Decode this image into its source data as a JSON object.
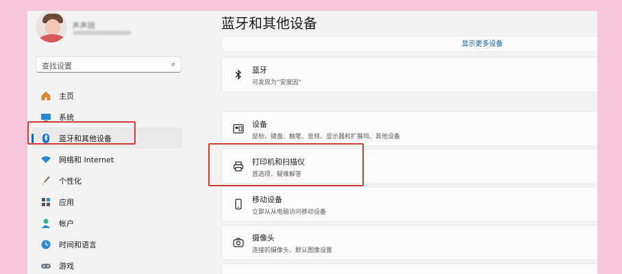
{
  "user": {
    "name": "声声回"
  },
  "search": {
    "placeholder": "查找设置"
  },
  "nav": [
    {
      "label": "主页",
      "icon": "home-icon"
    },
    {
      "label": "系统",
      "icon": "system-icon"
    },
    {
      "label": "蓝牙和其他设备",
      "icon": "bluetooth-icon",
      "selected": true
    },
    {
      "label": "网络和 Internet",
      "icon": "wifi-icon"
    },
    {
      "label": "个性化",
      "icon": "brush-icon"
    },
    {
      "label": "应用",
      "icon": "apps-icon"
    },
    {
      "label": "帐户",
      "icon": "account-icon"
    },
    {
      "label": "时间和语言",
      "icon": "globe-clock-icon"
    },
    {
      "label": "游戏",
      "icon": "gamepad-icon"
    }
  ],
  "main": {
    "title": "蓝牙和其他设备",
    "show_more": "显示更多设备",
    "bluetooth": {
      "title": "蓝牙",
      "subtitle": "可发现为“安度因”"
    },
    "rows": [
      {
        "title": "设备",
        "subtitle": "鼠标、键盘、触笔、音频、显示器和扩展坞、其他设备",
        "icon": "devices-icon"
      },
      {
        "title": "打印机和扫描仪",
        "subtitle": "首选项、疑难解答",
        "icon": "printer-icon"
      },
      {
        "title": "移动设备",
        "subtitle": "立即从从电脑访问移动设备",
        "icon": "phone-icon"
      },
      {
        "title": "摄像头",
        "subtitle": "连接的摄像头、默认图像设置",
        "icon": "camera-icon"
      }
    ]
  },
  "colors": {
    "accent": "#0067c0",
    "highlight": "#d33a36",
    "background": "#f7c6d8"
  }
}
